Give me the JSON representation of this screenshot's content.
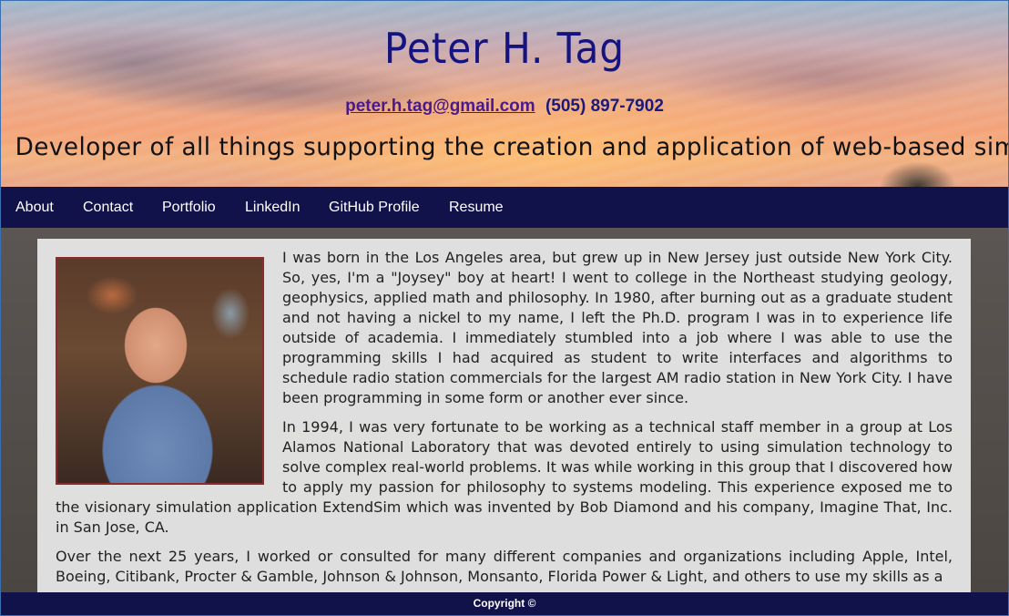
{
  "header": {
    "name": "Peter H. Tag",
    "email": "peter.h.tag@gmail.com",
    "phone": "(505) 897-7902",
    "tagline": "Developer of all things supporting the creation and application of web-based simulations"
  },
  "nav": {
    "items": [
      "About",
      "Contact",
      "Portfolio",
      "LinkedIn",
      "GitHub Profile",
      "Resume"
    ]
  },
  "main": {
    "photo_alt": "Photo of Peter H. Tag",
    "paragraphs": [
      "I was born in the Los Angeles area, but grew up in New Jersey just outside New York City. So, yes, I'm a \"Joysey\" boy at heart! I went to college in the Northeast studying geology, geophysics, applied math and philosophy. In 1980, after burning out as a graduate student and not having a nickel to my name, I left the Ph.D. program I was in to experience life outside of academia. I immediately stumbled into a job where I was able to use the programming skills I had acquired as student to write interfaces and algorithms to schedule radio station commercials for the largest AM radio station in New York City. I have been programming in some form or another ever since.",
      "In 1994, I was very fortunate to be working as a technical staff member in a group at Los Alamos National Laboratory that was devoted entirely to using simulation technology to solve complex real-world problems. It was while working in this group that I discovered how to apply my passion for philosophy to systems modeling. This experience exposed me to the visionary simulation application ExtendSim which was invented by Bob Diamond and his company, Imagine That, Inc. in San Jose, CA.",
      "Over the next 25 years, I worked or consulted for many different companies and organizations including Apple, Intel, Boeing, Citibank, Procter & Gamble, Johnson & Johnson, Monsanto, Florida Power & Light, and others to use my skills as a"
    ]
  },
  "footer": {
    "copyright": "Copyright ©"
  },
  "colors": {
    "nav_bg": "#12124a",
    "name_color": "#14137f",
    "photo_border": "#8b2b2b"
  }
}
